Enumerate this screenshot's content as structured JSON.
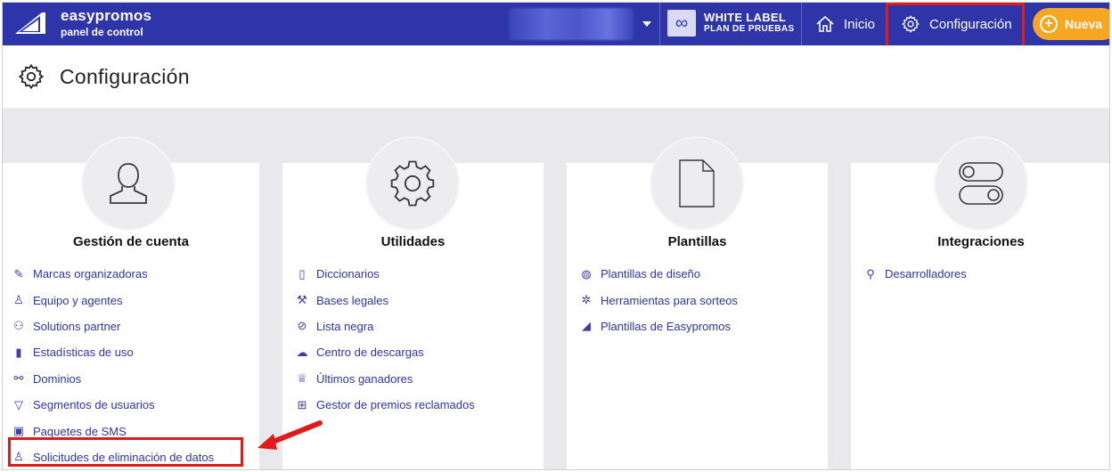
{
  "topbar": {
    "brand_name": "easypromos",
    "brand_sub": "panel de control",
    "plan_title": "WHITE LABEL",
    "plan_sub": "PLAN DE PRUEBAS",
    "plan_icon": "infinity-icon",
    "nav_inicio": "Inicio",
    "nav_config": "Configuración",
    "nueva": "Nueva",
    "accent_color": "#2d35a8",
    "nueva_color": "#f5a623"
  },
  "page": {
    "title": "Configuración",
    "icon": "gear-icon"
  },
  "cards": [
    {
      "title": "Gestión de cuenta",
      "icon": "user-icon",
      "links": [
        {
          "label": "Marcas organizadoras",
          "icon": "brand-icon"
        },
        {
          "label": "Equipo y agentes",
          "icon": "user-icon"
        },
        {
          "label": "Solutions partner",
          "icon": "partners-icon"
        },
        {
          "label": "Estadísticas de uso",
          "icon": "bar-chart-icon"
        },
        {
          "label": "Dominios",
          "icon": "link-icon"
        },
        {
          "label": "Segmentos de usuarios",
          "icon": "filter-icon"
        },
        {
          "label": "Paquetes de SMS",
          "icon": "package-icon"
        },
        {
          "label": "Solicitudes de eliminación de datos",
          "icon": "user-delete-icon"
        }
      ]
    },
    {
      "title": "Utilidades",
      "icon": "gear-icon",
      "links": [
        {
          "label": "Diccionarios",
          "icon": "book-icon"
        },
        {
          "label": "Bases legales",
          "icon": "gavel-icon"
        },
        {
          "label": "Lista negra",
          "icon": "ban-icon"
        },
        {
          "label": "Centro de descargas",
          "icon": "cloud-download-icon"
        },
        {
          "label": "Últimos ganadores",
          "icon": "trophy-icon"
        },
        {
          "label": "Gestor de premios reclamados",
          "icon": "gift-icon"
        }
      ]
    },
    {
      "title": "Plantillas",
      "icon": "document-icon",
      "links": [
        {
          "label": "Plantillas de diseño",
          "icon": "palette-icon"
        },
        {
          "label": "Herramientas para sorteos",
          "icon": "tools-icon"
        },
        {
          "label": "Plantillas de Easypromos",
          "icon": "easypromos-icon"
        }
      ]
    },
    {
      "title": "Integraciones",
      "icon": "toggles-icon",
      "links": [
        {
          "label": "Desarrolladores",
          "icon": "developer-icon"
        }
      ]
    }
  ]
}
